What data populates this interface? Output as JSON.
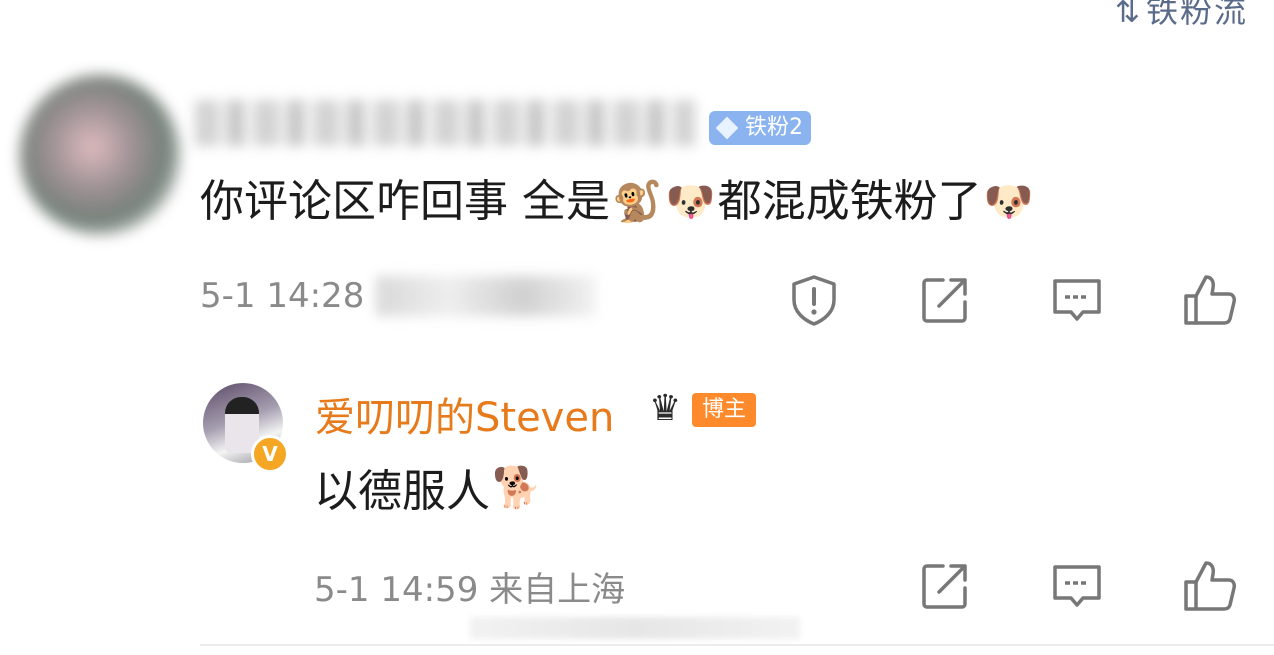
{
  "top": {
    "sort_label": "铁粉流",
    "sort_icon": "sort-icon"
  },
  "comment": {
    "badge": {
      "label": "铁粉2",
      "icon": "diamond-icon"
    },
    "text_before": "你评论区咋回事 全是",
    "emoji_monkey": "🐒",
    "emoji_husky": "🐶",
    "text_middle": " 都混成铁粉了",
    "timestamp": "5-1 14:28",
    "actions": [
      "report-icon",
      "share-icon",
      "comment-icon",
      "like-icon"
    ]
  },
  "reply": {
    "username": "爱叨叨的Steven",
    "verified_badge": "V",
    "crown_icon": "crown-icon",
    "host_badge": "博主",
    "text": "以德服人",
    "emoji_doge": "🐕",
    "meta": "5-1 14:59  来自上海",
    "actions": [
      "share-icon",
      "comment-icon",
      "like-icon"
    ]
  },
  "colors": {
    "username_orange": "#e77a1b",
    "badge_blue": "#8ab3f0",
    "host_orange": "#ff8a2b",
    "meta_gray": "#8a8a8a"
  }
}
